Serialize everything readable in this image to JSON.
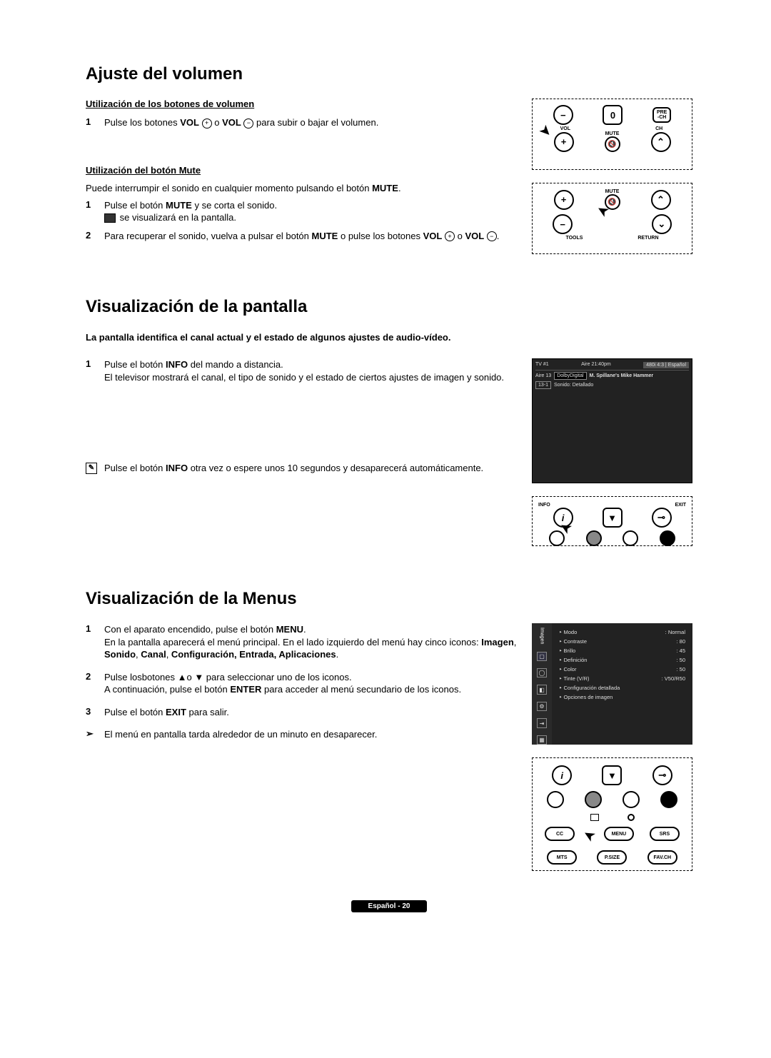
{
  "section1": {
    "title": "Ajuste del volumen",
    "sub1": "Utilización de los botones de volumen",
    "step1_pre": "Pulse los botones ",
    "step1_vol": "VOL",
    "step1_mid": " o ",
    "step1_post": " para subir o bajar el volumen.",
    "sub2": "Utilización del botón Mute",
    "mute_intro": "Puede interrumpir el sonido en cualquier momento pulsando el botón ",
    "mute_intro_b": "MUTE",
    "mute_intro_end": ".",
    "m1a": "Pulse el botón ",
    "m1b": "MUTE",
    "m1c": " y se corta el sonido.",
    "m1d": " se visualizará en la pantalla.",
    "m2a": "Para recuperar el sonido, vuelva a pulsar el botón ",
    "m2b": "MUTE",
    "m2c": " o pulse los botones ",
    "m2d": "VOL",
    "m2o": " o ",
    "m2e": "."
  },
  "remote1": {
    "zero": "0",
    "pre": "PRE\n-CH",
    "vol": "VOL",
    "ch": "CH",
    "mute": "MUTE",
    "plus": "+",
    "minus": "−",
    "up": "⌃",
    "down": "⌄",
    "tools": "TOOLS",
    "return": "RETURN"
  },
  "section2": {
    "title": "Visualización de la pantalla",
    "lead": "La pantalla identifica el canal actual y el estado de algunos ajustes de audio-vídeo.",
    "s1a": "Pulse el botón ",
    "s1b": "INFO",
    "s1c": " del mando a distancia.",
    "s1d": "El televisor mostrará el canal, el tipo de sonido y el estado de ciertos ajustes de imagen y sonido.",
    "note_a": "Pulse el botón ",
    "note_b": "INFO",
    "note_c": " otra vez o espere unos 10 segundos y desaparecerá automáticamente."
  },
  "tv": {
    "src": "TV #1",
    "time": "Aire 21:40pm",
    "st": "480i 4:3 | Español",
    "ch_a": "Aire 13",
    "ch_b": "DolbyDigital",
    "prog": "M. Spillane's Mike Hammer",
    "chnum": "13-1",
    "snd": "Sonido: Detallado"
  },
  "remote2": {
    "info": "INFO",
    "exit": "EXIT",
    "i": "i",
    "down": "▼",
    "ex": "⊸"
  },
  "section3": {
    "title": "Visualización de la Menus",
    "s1a": "Con el aparato encendido, pulse el botón ",
    "s1b": "MENU",
    "s1c": ".",
    "s1d": "En la pantalla aparecerá el menú principal. En el lado izquierdo del menú hay cinco iconos: ",
    "s1e": "Imagen",
    "s1f": ", ",
    "s1g": "Sonido",
    "s1h": ", ",
    "s1i": "Canal",
    "s1j": ", ",
    "s1k": "Configuración, Entrada, Aplicaciones",
    "s1l": ".",
    "s2a": "Pulse losbotones ▲o ▼ para seleccionar uno de los iconos.",
    "s2b": "A continuación, pulse el botón ",
    "s2c": "ENTER",
    "s2d": " para acceder al menú secundario de los iconos.",
    "s3a": "Pulse el botón ",
    "s3b": "EXIT",
    "s3c": " para salir.",
    "s4": "El menú en pantalla tarda alrededor de un minuto en desaparecer."
  },
  "menu": {
    "side": "Imagen",
    "items": [
      {
        "k": "Modo",
        "v": ": Normal"
      },
      {
        "k": "Contraste",
        "v": ": 80"
      },
      {
        "k": "Brillo",
        "v": ": 45"
      },
      {
        "k": "Definición",
        "v": ": 50"
      },
      {
        "k": "Color",
        "v": ": 50"
      },
      {
        "k": "Tinte (V/R)",
        "v": ": V50/R50"
      },
      {
        "k": "Configuración detallada",
        "v": ""
      },
      {
        "k": "Opciones de imagen",
        "v": ""
      }
    ]
  },
  "remote3": {
    "cc": "CC",
    "menu": "MENU",
    "srs": "SRS",
    "mts": "MTS",
    "psize": "P.SIZE",
    "favch": "FAV.CH"
  },
  "footer": "Español - 20"
}
